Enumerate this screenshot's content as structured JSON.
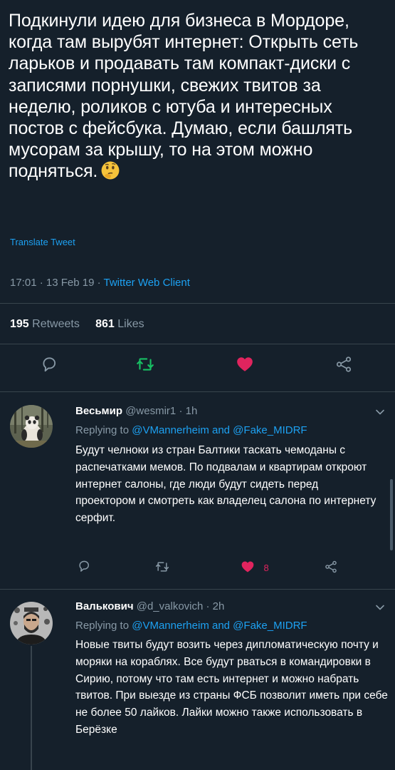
{
  "tweet": {
    "text": "Подкинули идею для бизнеса в Мордоре, когда там вырубят интернет: Открыть сеть ларьков и продавать там компакт-диски с записями порнушки, свежих твитов за неделю, роликов с ютуба и интересных постов с фейсбука. Думаю, если башлять мусорам за крышу, то на этом можно подняться.",
    "emoji": "thinking-face-emoji",
    "translate": "Translate Tweet",
    "time": "17:01 · 13 Feb 19 · ",
    "client": "Twitter Web Client",
    "retweets_count": "195",
    "retweets_label": "Retweets",
    "likes_count": "861",
    "likes_label": "Likes"
  },
  "icons": {
    "reply": "reply-icon",
    "retweet": "retweet-icon",
    "like": "heart-icon",
    "share": "share-icon",
    "more": "chevron-down-icon"
  },
  "colors": {
    "background": "#15202b",
    "accent": "#1da1f2",
    "retweet": "#17bf63",
    "like": "#e0245e",
    "muted": "#8899a6",
    "divider": "#38444d"
  },
  "replies": [
    {
      "name": "Весьмир",
      "handle": "@wesmir1 · 1h",
      "replying_prefix": "Replying to ",
      "replying_users": "@VMannerheim and @Fake_MIDRF",
      "text": "Будут челноки из стран Балтики таскать чемоданы с распечатками мемов. По подвалам и квартирам откроют интернет салоны, где люди будут сидеть перед проектором и смотреть как владелец салона по интернету серфит.",
      "likes": "8"
    },
    {
      "name": "Валькович",
      "handle": "@d_valkovich · 2h",
      "replying_prefix": "Replying to ",
      "replying_users": "@VMannerheim and @Fake_MIDRF",
      "text": "Новые твиты будут возить через дипломатическую почту и моряки на кораблях. Все будут рваться в командировки в Сирию, потому что там есть интернет и можно набрать твитов. При выезде из страны ФСБ позволит иметь при себе не более 50 лайков. Лайки можно также использовать в Берёзке"
    }
  ]
}
